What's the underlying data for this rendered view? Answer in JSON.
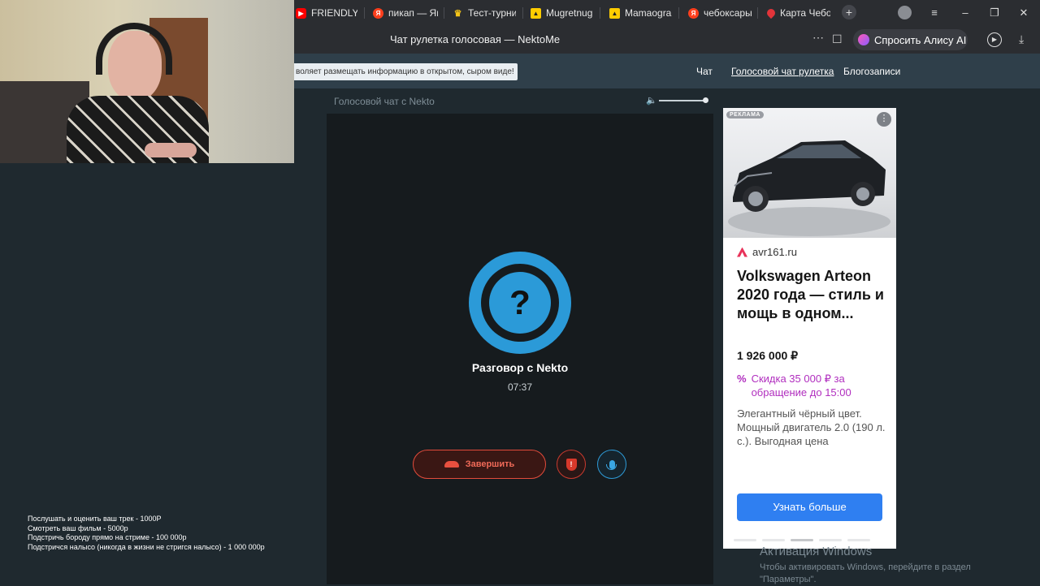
{
  "browser": {
    "tabs": [
      {
        "label": "FRIENDLY T",
        "icon": "youtube-icon",
        "color": "#ff0000"
      },
      {
        "label": "пикап — Ян",
        "icon": "yandex-icon",
        "color": "#fc3f1d"
      },
      {
        "label": "Тест-турни",
        "icon": "crown-icon",
        "color": "#f5c518"
      },
      {
        "label": "Mugretnug",
        "icon": "yandex-games-icon",
        "color": "#ffcc00"
      },
      {
        "label": "Mamaogra",
        "icon": "yandex-games-icon",
        "color": "#ffcc00"
      },
      {
        "label": "чебоксары",
        "icon": "yandex-icon",
        "color": "#fc3f1d"
      },
      {
        "label": "Карта Чебо",
        "icon": "map-pin-icon",
        "color": "#e2343a"
      }
    ],
    "page_title": "Чат рулетка голосовая — NektoMe",
    "alice_label": "Спросить Алису AI"
  },
  "site": {
    "notice": "воляет размещать информацию в открытом, сыром виде!",
    "nav": [
      {
        "label": "Чат"
      },
      {
        "label": "Голосовой чат рулетка"
      },
      {
        "label": "Блогозаписи"
      }
    ]
  },
  "chat": {
    "header": "Голосовой чат с Nekto",
    "volume_level": 1.0,
    "avatar_glyph": "?",
    "conversation_title": "Разговор с Nekto",
    "timer": "07:37",
    "end_label": "Завершить",
    "accent_blue": "#2b9ad8",
    "accent_red": "#e24b3b"
  },
  "ad": {
    "badge": "РЕКЛАМА",
    "more": "⋮",
    "domain": "avr161.ru",
    "title": "Volkswagen Arteon 2020 года — стиль и мощь в одном...",
    "price": "1 926 000 ₽",
    "discount_icon": "%",
    "discount": "Скидка 35 000 ₽ за обращение до 15:00",
    "description": "Элегантный чёрный цвет. Мощный двигатель 2.0 (190 л. с.). Выгодная цена",
    "cta": "Узнать больше",
    "carousel_active": 2,
    "carousel_count": 5
  },
  "stream_overlay": {
    "donations": [
      "Послушать и оценить ваш трек - 1000Р",
      "Смотреть ваш фильм - 5000р",
      "Подстричь бороду прямо на стриме - 100 000р",
      "Подстричся налысо (никогда в жизни не стригся налысо) - 1 000 000р"
    ]
  },
  "windows_watermark": {
    "title": "Активация Windows",
    "line1": "Чтобы активировать Windows, перейдите в раздел",
    "line2": "\"Параметры\"."
  }
}
